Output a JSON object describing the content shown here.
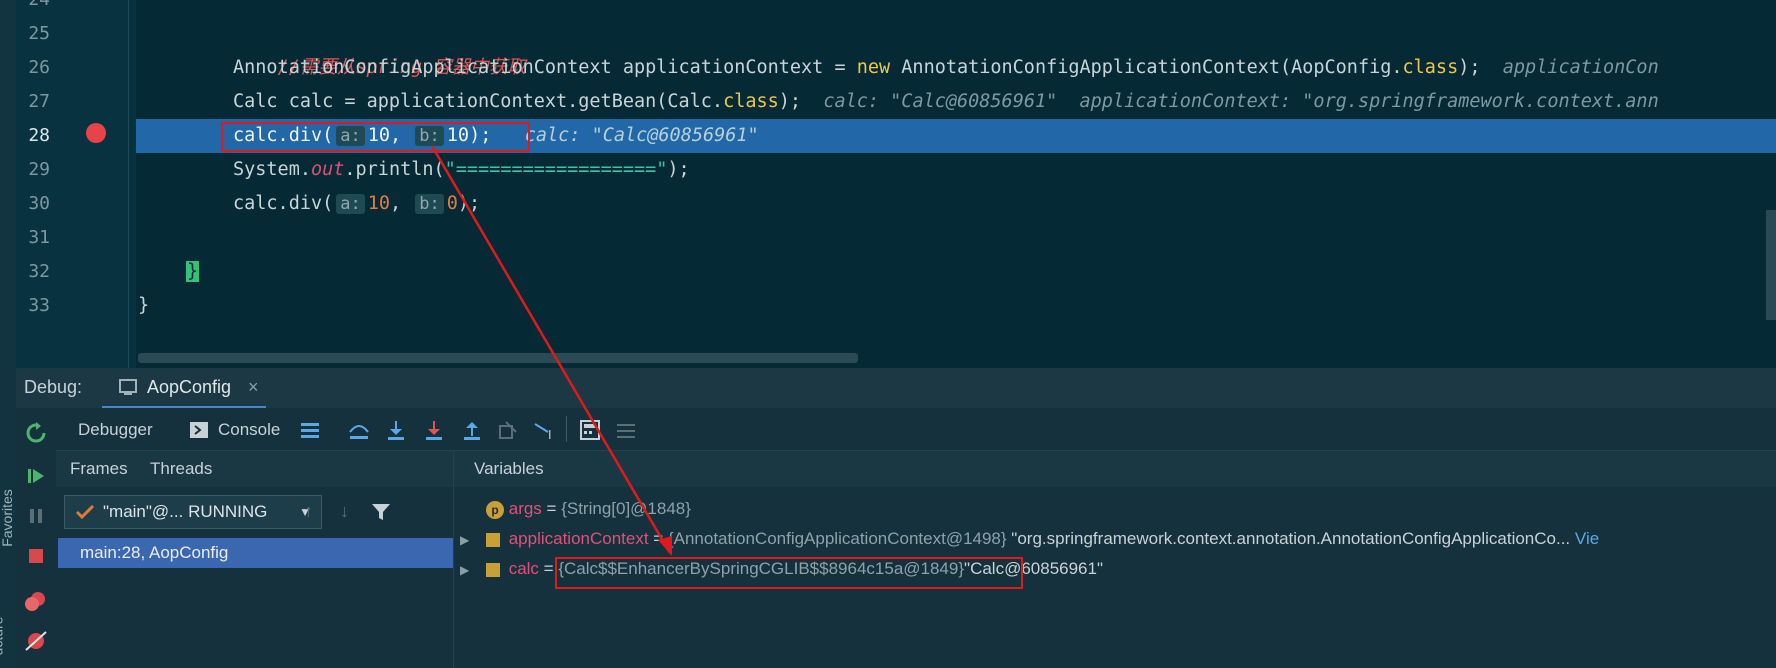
{
  "editor": {
    "lines": [
      {
        "num": "24",
        "text": ""
      },
      {
        "num": "25",
        "comment": "//需要从spring 容器中获取"
      },
      {
        "num": "26",
        "pre": "AnnotationConfigApplicationContext applicationContext = ",
        "kw": "new",
        "post": " AnnotationConfigApplicationContext(AopConfig.",
        "kw2": "class",
        "post2": ");",
        "hint": "applicationCon"
      },
      {
        "num": "27",
        "pre": "Calc calc = applicationContext.getBean(Calc.",
        "kw": "class",
        "post": ");",
        "hint1": "calc: \"Calc@60856961\"",
        "hint2": "applicationContext: \"org.springframework.context.ann"
      },
      {
        "num": "28",
        "pre": "calc.div(",
        "inlay_a": "a:",
        "val_a": "10",
        "sep": ", ",
        "inlay_b": "b:",
        "val_b": "10",
        "post": ");",
        "hint": "calc: \"Calc@60856961\""
      },
      {
        "num": "29",
        "pre": "System.",
        "out": "out",
        "post": ".println(",
        "str": "\"==================\"",
        "post2": ");"
      },
      {
        "num": "30",
        "pre": "calc.div(",
        "inlay_a": "a:",
        "val_a": "10",
        "sep": ", ",
        "inlay_b": "b:",
        "val_b": "0",
        "post": ");"
      },
      {
        "num": "31",
        "text": ""
      },
      {
        "num": "32",
        "brace": "}"
      },
      {
        "num": "33",
        "text": "}"
      }
    ]
  },
  "debug": {
    "label": "Debug:",
    "config": "AopConfig",
    "close": "×",
    "tabs": {
      "debugger": "Debugger",
      "console": "Console"
    },
    "subtabs": {
      "frames": "Frames",
      "threads": "Threads",
      "variables": "Variables"
    },
    "thread": "\"main\"@... RUNNING",
    "frame": "main:28, AopConfig",
    "side_labels": {
      "favorites": "Favorites",
      "structure": "ucture"
    }
  },
  "variables": [
    {
      "name": "args",
      "eq": " = ",
      "value": "{String[0]@1848}",
      "extra": ""
    },
    {
      "name": "applicationContext",
      "eq": " = ",
      "value": "{AnnotationConfigApplicationContext@1498}",
      "extra": " \"org.springframework.context.annotation.AnnotationConfigApplicationCo...",
      "link": "Vie"
    },
    {
      "name": "calc",
      "eq": " = ",
      "value": "{Calc$$EnhancerBySpringCGLIB$$8964c15a@1849}",
      "extra": "\"Calc@60856961\""
    }
  ],
  "colors": {
    "highlight": "#2267a8",
    "annotation": "#e01a1a",
    "breakpoint": "#e8434b"
  }
}
